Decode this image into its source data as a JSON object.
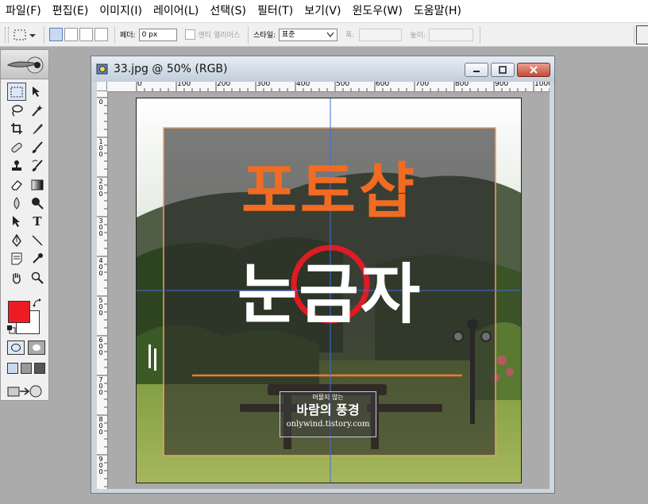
{
  "menu": [
    "파일(F)",
    "편집(E)",
    "이미지(I)",
    "레이어(L)",
    "선택(S)",
    "필터(T)",
    "보기(V)",
    "윈도우(W)",
    "도움말(H)"
  ],
  "options": {
    "feather_label": "페더:",
    "feather_value": "0 px",
    "antialias_label": "앤티 앨리어스",
    "style_label": "스타일:",
    "style_value": "표준",
    "width_label": "폭:",
    "height_label": "높이:"
  },
  "document": {
    "title": "33.jpg @ 50% (RGB)",
    "ruler_labels": [
      "0",
      "100",
      "200",
      "300",
      "400",
      "500",
      "600",
      "700",
      "800",
      "900",
      "1000"
    ]
  },
  "image": {
    "headline": "포토샵",
    "subheadline_left": "눈",
    "subheadline_mid": "금",
    "subheadline_right": "자",
    "badge_small": "머물지 않는",
    "badge_title": "바람의 풍경",
    "badge_url": "onlywind.tistory.com"
  },
  "colors": {
    "headline": "#f26b23",
    "foreground_swatch": "#ed1c24",
    "circle": "#e01b24",
    "guide": "#3d6fe0"
  },
  "icons": [
    "marquee-icon",
    "move-icon",
    "lasso-icon",
    "magic-wand-icon",
    "crop-icon",
    "slice-icon",
    "healing-brush-icon",
    "brush-icon",
    "stamp-icon",
    "history-brush-icon",
    "eraser-icon",
    "gradient-icon",
    "blur-icon",
    "dodge-icon",
    "path-select-icon",
    "type-icon",
    "pen-icon",
    "line-icon",
    "notes-icon",
    "eyedropper-icon",
    "hand-icon",
    "zoom-icon"
  ]
}
